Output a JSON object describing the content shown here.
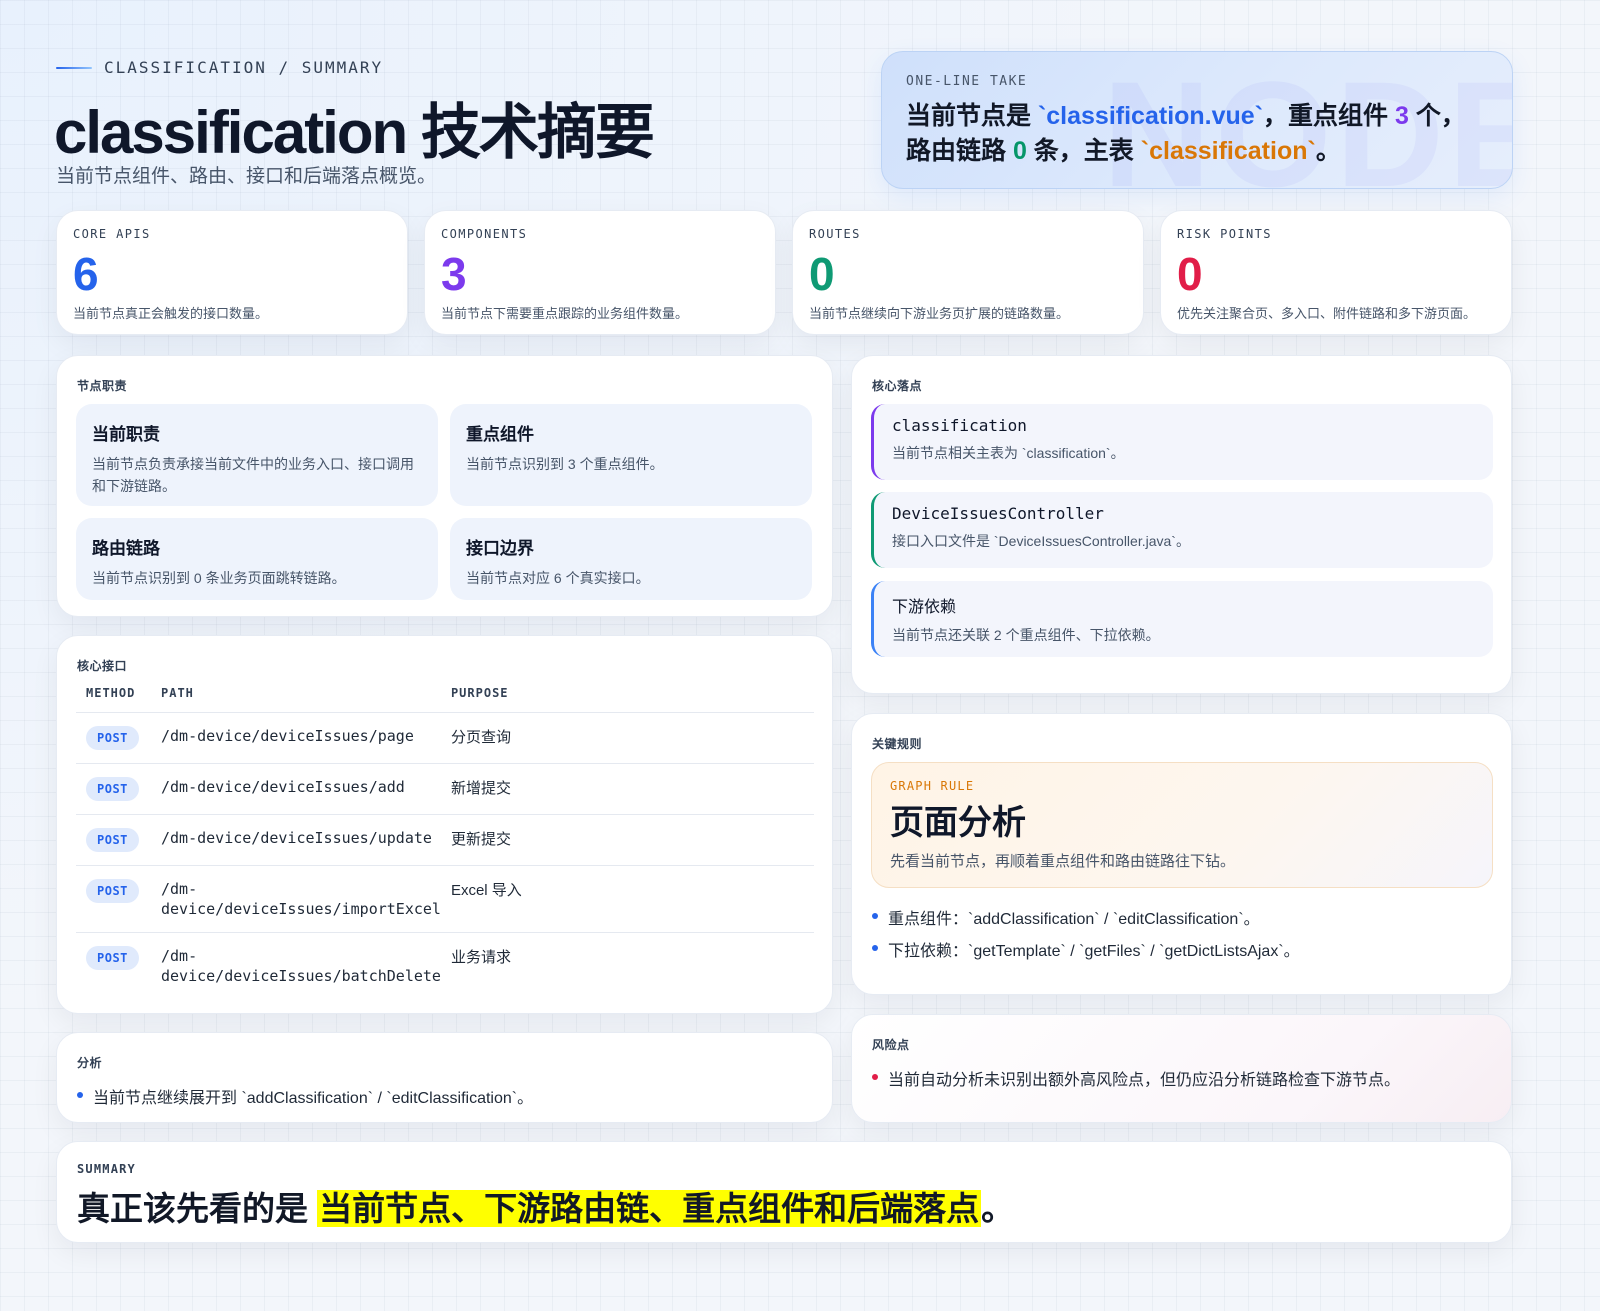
{
  "header": {
    "eyebrow": "CLASSIFICATION / SUMMARY",
    "title": "classification 技术摘要",
    "subtitle": "当前节点组件、路由、接口和后端落点概览。"
  },
  "take": {
    "label": "ONE-LINE TAKE",
    "watermark": "NODE",
    "p1": "当前节点是 ",
    "file": "`classification.vue`",
    "p2": "，重点组件 ",
    "components": "3",
    "p3": " 个，路由链路 ",
    "routes": "0",
    "p4": " 条，主表 ",
    "table": "`classification`",
    "p5": "。"
  },
  "stats": [
    {
      "label": "CORE APIS",
      "value": "6",
      "desc": "当前节点真正会触发的接口数量。",
      "color": "#2563eb"
    },
    {
      "label": "COMPONENTS",
      "value": "3",
      "desc": "当前节点下需要重点跟踪的业务组件数量。",
      "color": "#7c3aed"
    },
    {
      "label": "ROUTES",
      "value": "0",
      "desc": "当前节点继续向下游业务页扩展的链路数量。",
      "color": "#0f9a74"
    },
    {
      "label": "RISK POINTS",
      "value": "0",
      "desc": "优先关注聚合页、多入口、附件链路和多下游页面。",
      "color": "#e11d48"
    }
  ],
  "duties": {
    "label": "节点职责",
    "items": [
      {
        "title": "当前职责",
        "desc": "当前节点负责承接当前文件中的业务入口、接口调用和下游链路。"
      },
      {
        "title": "重点组件",
        "desc": "当前节点识别到 3 个重点组件。"
      },
      {
        "title": "路由链路",
        "desc": "当前节点识别到 0 条业务页面跳转链路。"
      },
      {
        "title": "接口边界",
        "desc": "当前节点对应 6 个真实接口。"
      }
    ]
  },
  "apis": {
    "label": "核心接口",
    "columns": [
      "METHOD",
      "PATH",
      "PURPOSE"
    ],
    "rows": [
      {
        "method": "POST",
        "path": "/dm-device/deviceIssues/page",
        "purpose": "分页查询"
      },
      {
        "method": "POST",
        "path": "/dm-device/deviceIssues/add",
        "purpose": "新增提交"
      },
      {
        "method": "POST",
        "path": "/dm-device/deviceIssues/update",
        "purpose": "更新提交"
      },
      {
        "method": "POST",
        "path": "/dm-device/deviceIssues/importExcel",
        "purpose": "Excel 导入"
      },
      {
        "method": "POST",
        "path": "/dm-device/deviceIssues/batchDelete",
        "purpose": "业务请求"
      }
    ]
  },
  "anchors": {
    "label": "核心落点",
    "items": [
      {
        "title": "classification",
        "desc": "当前节点相关主表为 `classification`。",
        "color": "#7c3aed"
      },
      {
        "title": "DeviceIssuesController",
        "desc": "接口入口文件是 `DeviceIssuesController.java`。",
        "color": "#0f9a74"
      },
      {
        "title": "下游依赖",
        "desc": "当前节点还关联 2 个重点组件、下拉依赖。",
        "color": "#3b82f6"
      }
    ]
  },
  "rules": {
    "label": "关键规则",
    "box_label": "GRAPH RULE",
    "box_title": "页面分析",
    "box_desc": "先看当前节点，再顺着重点组件和路由链路往下钻。",
    "bullets": [
      "重点组件：`addClassification` / `editClassification`。",
      "下拉依赖：`getTemplate` / `getFiles` / `getDictListsAjax`。"
    ]
  },
  "analysis": {
    "label": "分析",
    "bullet": "当前节点继续展开到 `addClassification` / `editClassification`。"
  },
  "risk": {
    "label": "风险点",
    "bullet": "当前自动分析未识别出额外高风险点，但仍应沿分析链路检查下游节点。"
  },
  "summary": {
    "label": "SUMMARY",
    "lead": "真正该先看的是 ",
    "highlight": "当前节点、下游路由链、重点组件和后端落点",
    "tail": "。"
  }
}
